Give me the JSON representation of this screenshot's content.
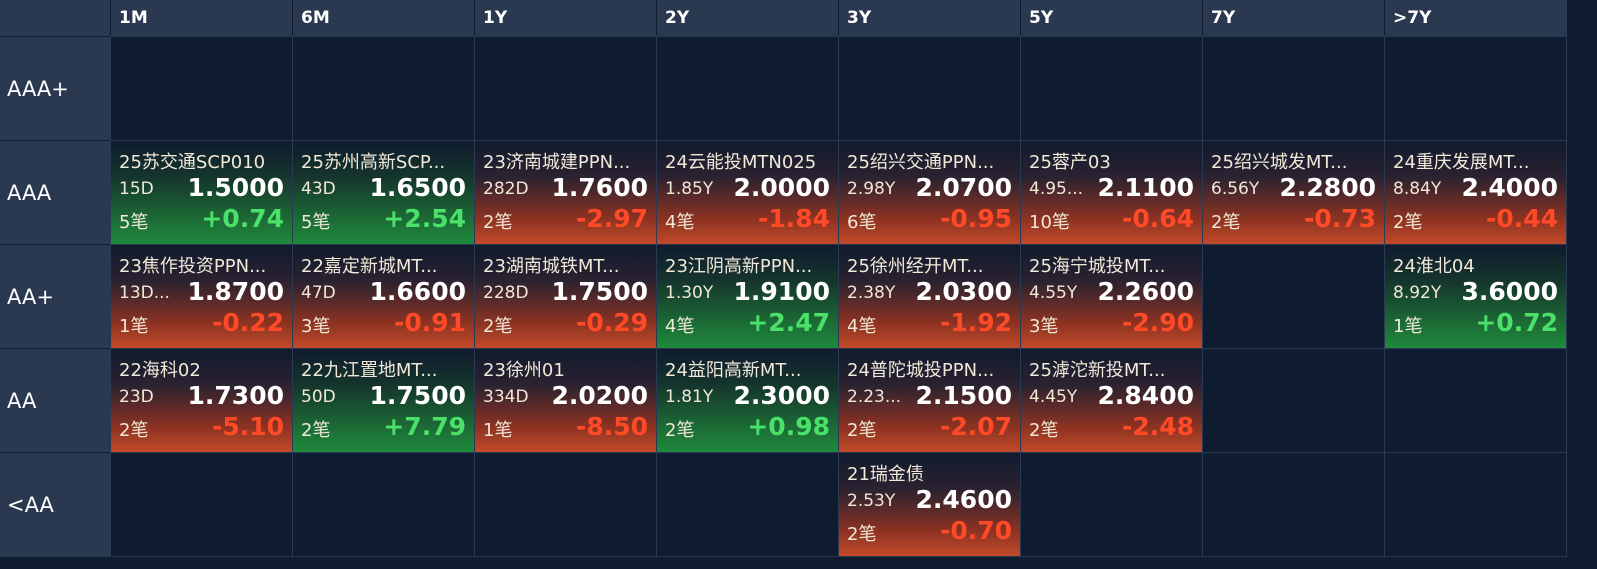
{
  "colors": {
    "background": "#0f1b2e",
    "header": "#2a3850",
    "up": "#1f8a3c",
    "down": "#c14a28",
    "positive_text": "#4be06a",
    "negative_text": "#ff4a28"
  },
  "columns": [
    "1M",
    "6M",
    "1Y",
    "2Y",
    "3Y",
    "5Y",
    "7Y",
    ">7Y"
  ],
  "rows": [
    {
      "label": "AAA+",
      "cells": [
        null,
        null,
        null,
        null,
        null,
        null,
        null,
        null
      ]
    },
    {
      "label": "AAA",
      "cells": [
        {
          "name": "25苏交通SCP010",
          "term": "15D",
          "rate": "1.5000",
          "count": "5笔",
          "change": "+0.74",
          "trend": "up"
        },
        {
          "name": "25苏州高新SCP...",
          "term": "43D",
          "rate": "1.6500",
          "count": "5笔",
          "change": "+2.54",
          "trend": "up"
        },
        {
          "name": "23济南城建PPN...",
          "term": "282D",
          "rate": "1.7600",
          "count": "2笔",
          "change": "-2.97",
          "trend": "down"
        },
        {
          "name": "24云能投MTN025",
          "term": "1.85Y",
          "rate": "2.0000",
          "count": "4笔",
          "change": "-1.84",
          "trend": "down"
        },
        {
          "name": "25绍兴交通PPN...",
          "term": "2.98Y",
          "rate": "2.0700",
          "count": "6笔",
          "change": "-0.95",
          "trend": "down"
        },
        {
          "name": "25蓉产03",
          "term": "4.95...",
          "rate": "2.1100",
          "count": "10笔",
          "change": "-0.64",
          "trend": "down"
        },
        {
          "name": "25绍兴城发MT...",
          "term": "6.56Y",
          "rate": "2.2800",
          "count": "2笔",
          "change": "-0.73",
          "trend": "down"
        },
        {
          "name": "24重庆发展MT...",
          "term": "8.84Y",
          "rate": "2.4000",
          "count": "2笔",
          "change": "-0.44",
          "trend": "down"
        }
      ]
    },
    {
      "label": "AA+",
      "cells": [
        {
          "name": "23焦作投资PPN...",
          "term": "13D...",
          "rate": "1.8700",
          "count": "1笔",
          "change": "-0.22",
          "trend": "down"
        },
        {
          "name": "22嘉定新城MT...",
          "term": "47D",
          "rate": "1.6600",
          "count": "3笔",
          "change": "-0.91",
          "trend": "down"
        },
        {
          "name": "23湖南城铁MT...",
          "term": "228D",
          "rate": "1.7500",
          "count": "2笔",
          "change": "-0.29",
          "trend": "down"
        },
        {
          "name": "23江阴高新PPN...",
          "term": "1.30Y",
          "rate": "1.9100",
          "count": "4笔",
          "change": "+2.47",
          "trend": "up"
        },
        {
          "name": "25徐州经开MT...",
          "term": "2.38Y",
          "rate": "2.0300",
          "count": "4笔",
          "change": "-1.92",
          "trend": "down"
        },
        {
          "name": "25海宁城投MT...",
          "term": "4.55Y",
          "rate": "2.2600",
          "count": "3笔",
          "change": "-2.90",
          "trend": "down"
        },
        null,
        {
          "name": "24淮北04",
          "term": "8.92Y",
          "rate": "3.6000",
          "count": "1笔",
          "change": "+0.72",
          "trend": "up"
        }
      ]
    },
    {
      "label": "AA",
      "cells": [
        {
          "name": "22海科02",
          "term": "23D",
          "rate": "1.7300",
          "count": "2笔",
          "change": "-5.10",
          "trend": "down"
        },
        {
          "name": "22九江置地MT...",
          "term": "50D",
          "rate": "1.7500",
          "count": "2笔",
          "change": "+7.79",
          "trend": "up"
        },
        {
          "name": "23徐州01",
          "term": "334D",
          "rate": "2.0200",
          "count": "1笔",
          "change": "-8.50",
          "trend": "down"
        },
        {
          "name": "24益阳高新MT...",
          "term": "1.81Y",
          "rate": "2.3000",
          "count": "2笔",
          "change": "+0.98",
          "trend": "up"
        },
        {
          "name": "24普陀城投PPN...",
          "term": "2.23...",
          "rate": "2.1500",
          "count": "2笔",
          "change": "-2.07",
          "trend": "down"
        },
        {
          "name": "25滹沱新投MT...",
          "term": "4.45Y",
          "rate": "2.8400",
          "count": "2笔",
          "change": "-2.48",
          "trend": "down"
        },
        null,
        null
      ]
    },
    {
      "label": "<AA",
      "cells": [
        null,
        null,
        null,
        null,
        {
          "name": "21瑞金债",
          "term": "2.53Y",
          "rate": "2.4600",
          "count": "2笔",
          "change": "-0.70",
          "trend": "down"
        },
        null,
        null,
        null
      ]
    }
  ]
}
